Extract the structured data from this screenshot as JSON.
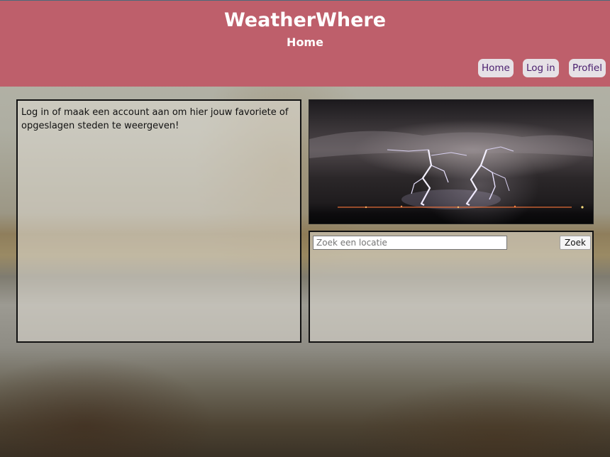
{
  "header": {
    "app_title": "WeatherWhere",
    "page_subtitle": "Home",
    "background_color": "#be5f6b"
  },
  "nav": {
    "items": [
      {
        "label": "Home"
      },
      {
        "label": "Log in"
      },
      {
        "label": "Profiel"
      }
    ]
  },
  "favorites_panel": {
    "message": "Log in of maak een account aan om hier jouw favoriete of opgeslagen steden te weergeven!"
  },
  "weather_image": {
    "subject": "lightning-storm-over-city-at-night"
  },
  "search": {
    "placeholder": "Zoek een locatie",
    "value": "",
    "button_label": "Zoek"
  }
}
